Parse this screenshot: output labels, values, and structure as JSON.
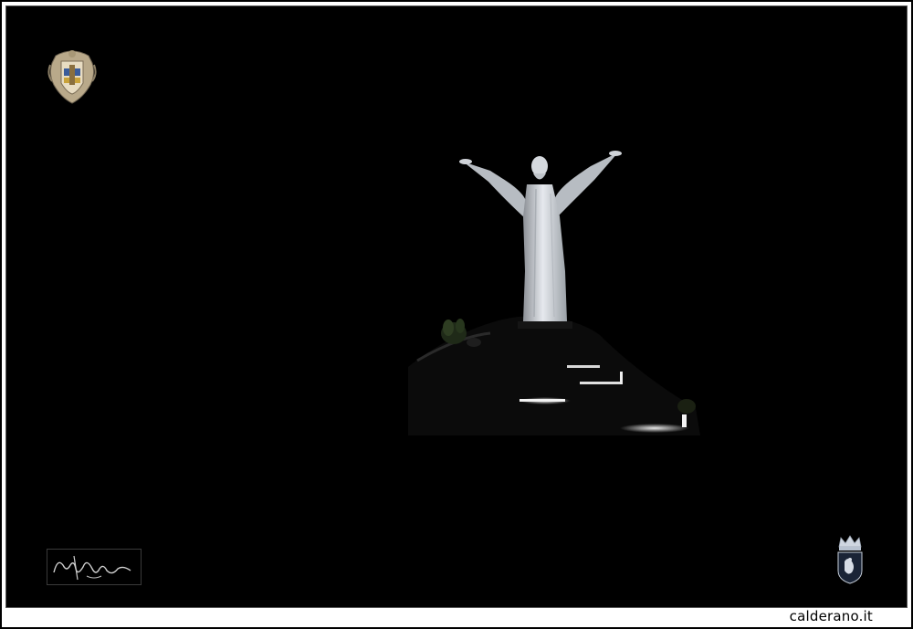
{
  "caption": {
    "text": "calderano.it"
  },
  "colors": {
    "background": "#000000",
    "frame": "#ffffff",
    "statue": "#d9dde2",
    "lamp": "#f2f2f2",
    "caption_text": "#000000"
  },
  "icons": {
    "top_left": "coat-of-arms-icon",
    "bottom_left": "signature-mark",
    "bottom_right": "crowned-shield-icon"
  }
}
